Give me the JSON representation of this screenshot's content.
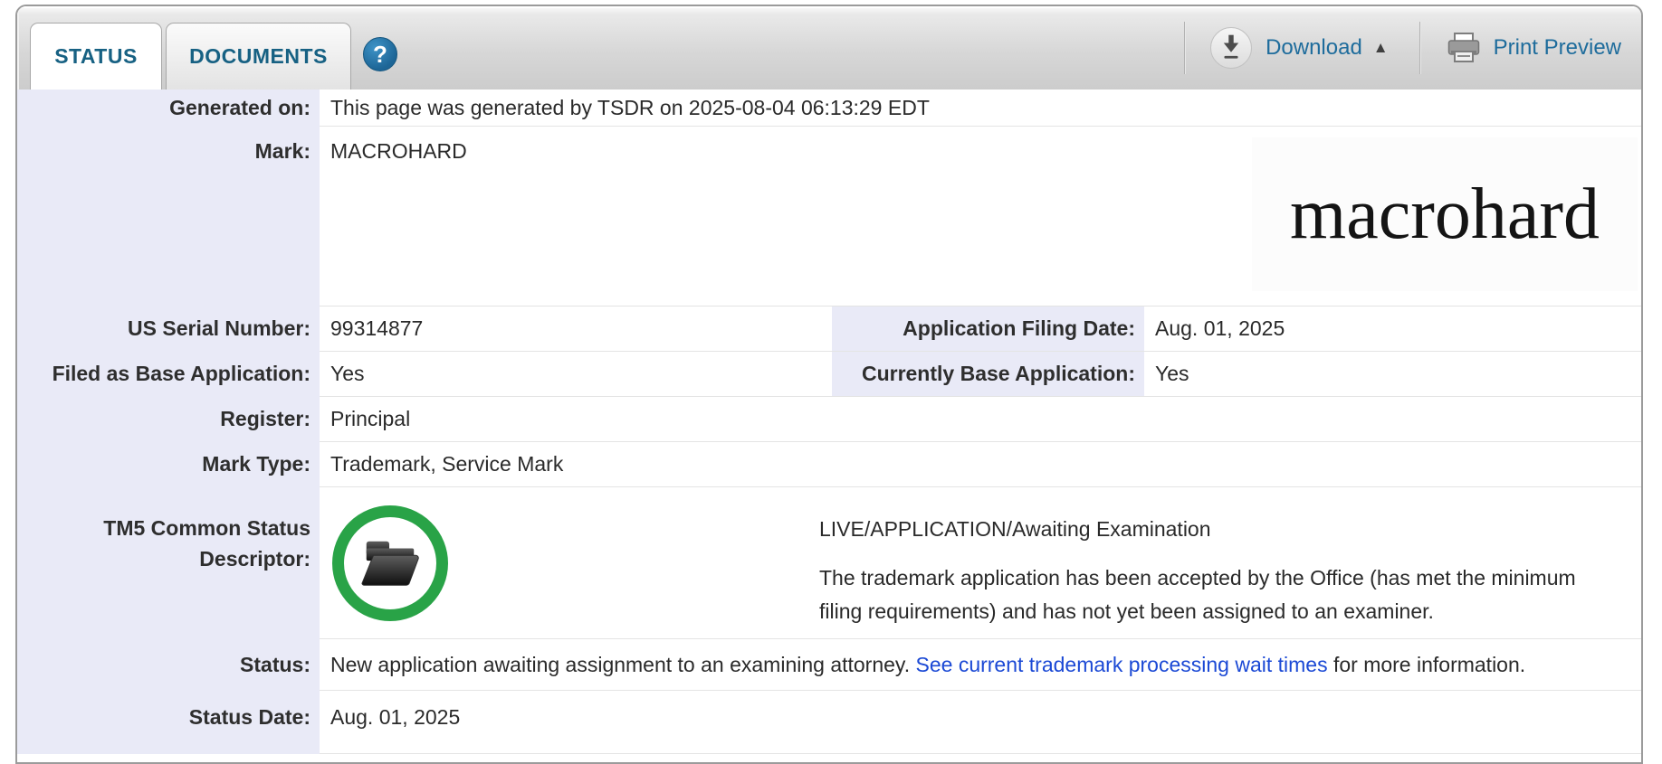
{
  "header": {
    "tabs": [
      {
        "label": "STATUS",
        "active": true
      },
      {
        "label": "DOCUMENTS",
        "active": false
      }
    ],
    "help_icon": "?",
    "download": {
      "label": "Download",
      "caret": "▲"
    },
    "print": {
      "label": "Print Preview"
    }
  },
  "record": {
    "generated_on": {
      "label": "Generated on:",
      "value": "This page was generated by TSDR on 2025-08-04 06:13:29 EDT"
    },
    "mark": {
      "label": "Mark:",
      "value": "MACROHARD",
      "logo_text": "macrohard"
    },
    "serial_number": {
      "label": "US Serial Number:",
      "value": "99314877"
    },
    "filing_date": {
      "label": "Application Filing Date:",
      "value": "Aug. 01, 2025"
    },
    "filed_as_base": {
      "label": "Filed as Base Application:",
      "value": "Yes"
    },
    "currently_base": {
      "label": "Currently Base Application:",
      "value": "Yes"
    },
    "register": {
      "label": "Register:",
      "value": "Principal"
    },
    "mark_type": {
      "label": "Mark Type:",
      "value": "Trademark, Service Mark"
    },
    "tm5": {
      "label": "TM5 Common Status Descriptor:",
      "icon": "open-folder-in-green-circle",
      "status": "LIVE/APPLICATION/Awaiting Examination",
      "description": "The trademark application has been accepted by the Office (has met the minimum filing requirements) and has not yet been assigned to an examiner."
    },
    "status": {
      "label": "Status:",
      "text_before": "New application awaiting assignment to an examining attorney. ",
      "link_text": "See current trademark processing wait times",
      "text_after": " for more information."
    },
    "status_date": {
      "label": "Status Date:",
      "value": "Aug. 01, 2025"
    }
  },
  "colors": {
    "label_bg": "#e9eaf7",
    "row_border": "#e4e4e4",
    "tab_text": "#176183",
    "toolbar_text": "#1e6c9c",
    "help_icon_bg": "#2175ad",
    "link_blue": "#1b49d5",
    "tm5_ring_green": "#29a347"
  }
}
